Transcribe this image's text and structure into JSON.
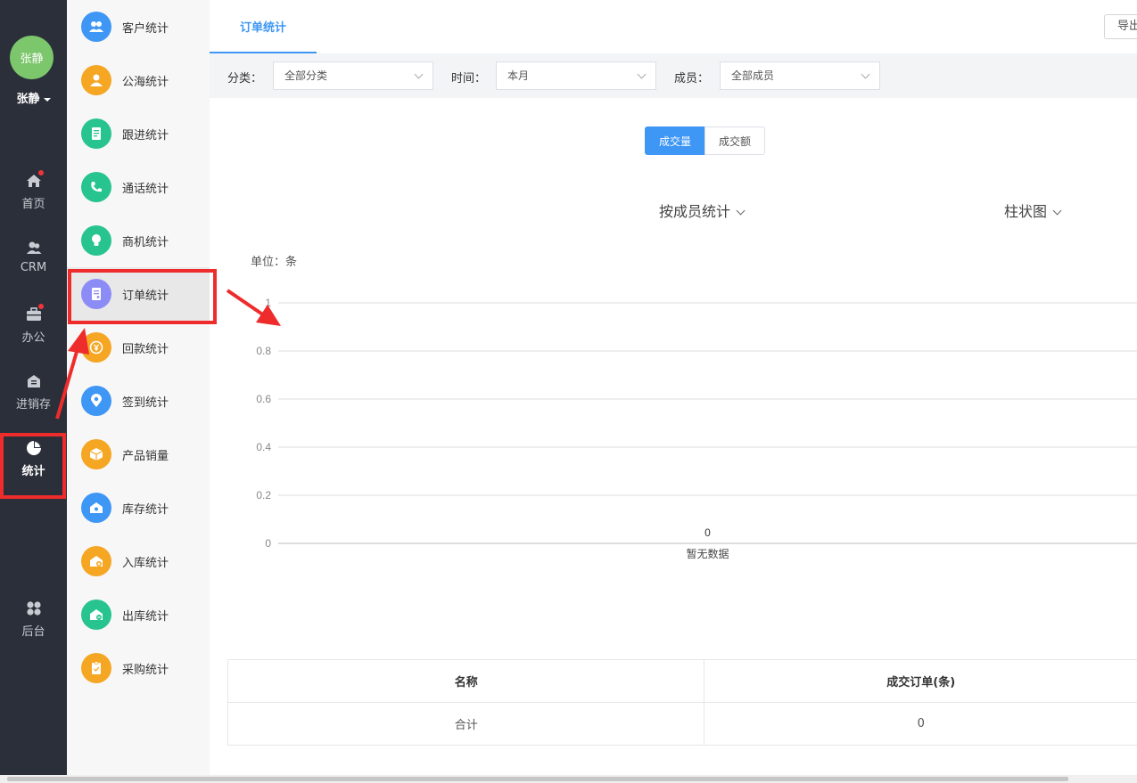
{
  "user": {
    "avatar_text": "张静",
    "name": "张静"
  },
  "nav": {
    "items": [
      {
        "label": "首页",
        "icon": "home-icon",
        "badge": true
      },
      {
        "label": "CRM",
        "icon": "crm-users-icon",
        "badge": false
      },
      {
        "label": "办公",
        "icon": "briefcase-icon",
        "badge": true
      },
      {
        "label": "进销存",
        "icon": "warehouse-icon",
        "badge": false
      },
      {
        "label": "统计",
        "icon": "pie-chart-icon",
        "badge": false,
        "active": true
      },
      {
        "label": "后台",
        "icon": "grid-icon",
        "badge": false
      }
    ]
  },
  "submenu": {
    "items": [
      {
        "label": "客户统计",
        "icon": "customer-icon",
        "color": "#3e96f5"
      },
      {
        "label": "公海统计",
        "icon": "person-icon",
        "color": "#f5a623"
      },
      {
        "label": "跟进统计",
        "icon": "notebook-icon",
        "color": "#27c48f"
      },
      {
        "label": "通话统计",
        "icon": "phone-icon",
        "color": "#27c48f"
      },
      {
        "label": "商机统计",
        "icon": "lightbulb-icon",
        "color": "#27c48f"
      },
      {
        "label": "订单统计",
        "icon": "order-icon",
        "color": "#8c8cf7",
        "active": true
      },
      {
        "label": "回款统计",
        "icon": "payment-icon",
        "color": "#f5a623"
      },
      {
        "label": "签到统计",
        "icon": "location-icon",
        "color": "#3e96f5"
      },
      {
        "label": "产品销量",
        "icon": "box-icon",
        "color": "#f5a623"
      },
      {
        "label": "库存统计",
        "icon": "inventory-icon",
        "color": "#3e96f5"
      },
      {
        "label": "入库统计",
        "icon": "stock-in-icon",
        "color": "#f5a623"
      },
      {
        "label": "出库统计",
        "icon": "stock-out-icon",
        "color": "#27c48f"
      },
      {
        "label": "采购统计",
        "icon": "purchase-icon",
        "color": "#f5a623"
      }
    ]
  },
  "header": {
    "tab": "订单统计",
    "export_label": "导出"
  },
  "filters": {
    "category_label": "分类：",
    "category_value": "全部分类",
    "time_label": "时间：",
    "time_value": "本月",
    "member_label": "成员：",
    "member_value": "全部成员"
  },
  "toggle": {
    "option1": "成交量",
    "option2": "成交额",
    "selected": "成交量"
  },
  "dropdowns": {
    "group_by": "按成员统计",
    "chart_type": "柱状图"
  },
  "chart_data": {
    "type": "bar",
    "unit_label": "单位：条",
    "ylim": [
      0,
      1
    ],
    "yticks": [
      "1",
      "0.8",
      "0.6",
      "0.4",
      "0.2",
      "0"
    ],
    "categories": [
      "暂无数据"
    ],
    "values": [
      0
    ],
    "data_labels": [
      "0"
    ],
    "grid": true
  },
  "table": {
    "headers": [
      "名称",
      "成交订单(条)"
    ],
    "rows": [
      [
        "合计",
        "0"
      ]
    ]
  },
  "annotation_color": "#ee2c2c"
}
